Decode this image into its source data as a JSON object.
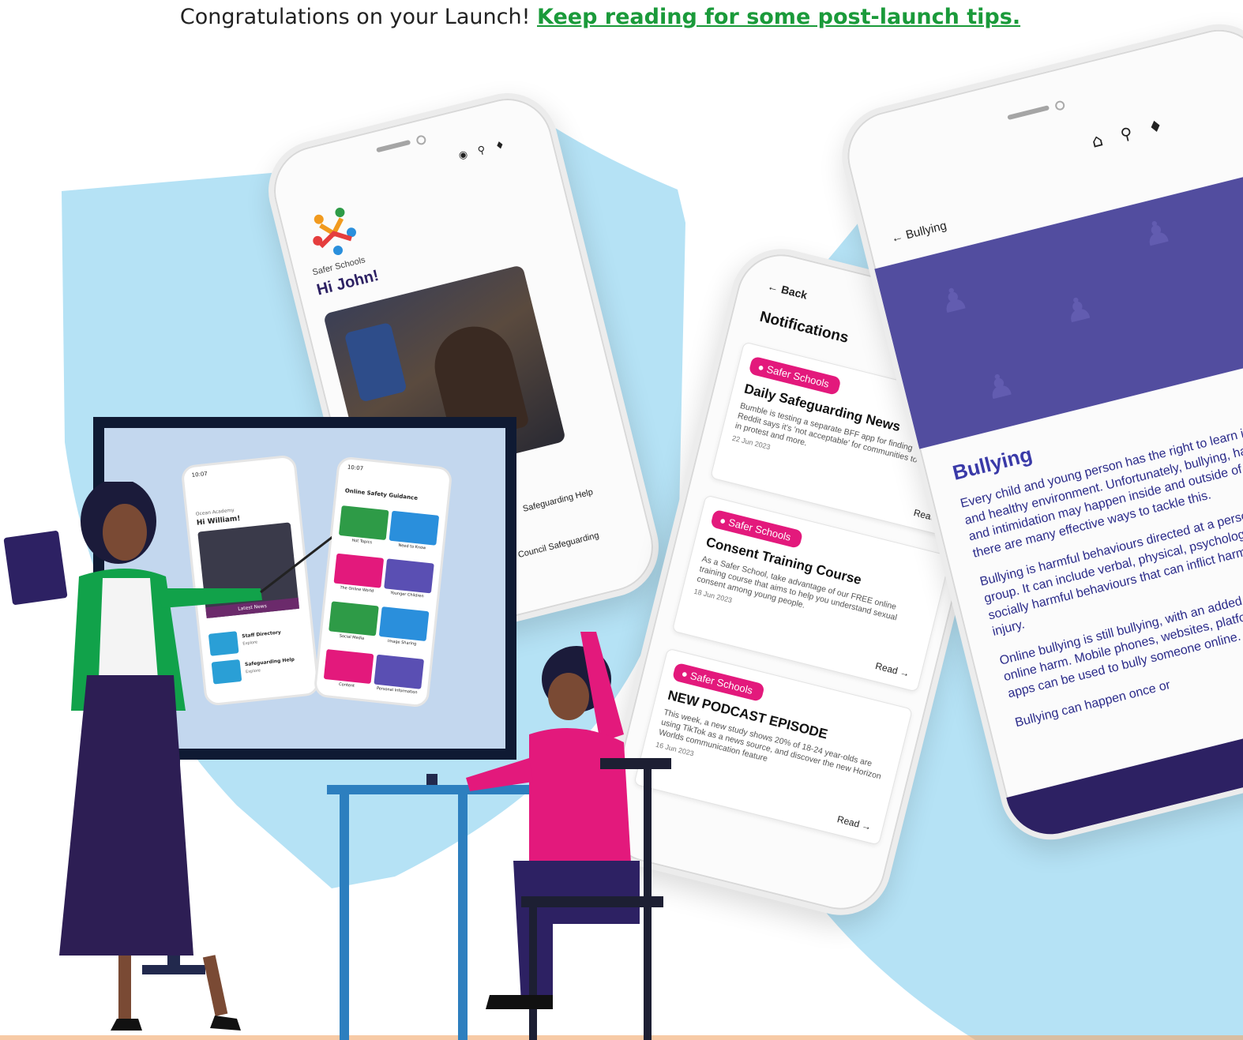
{
  "banner": {
    "lead": "Congratulations on your Launch!",
    "link": "Keep reading for some post-launch tips."
  },
  "colors": {
    "shield": "#b5e2f5",
    "link_green": "#1a9a3a",
    "purple": "#524d9f",
    "pink": "#e3197c",
    "navy": "#2d2163"
  },
  "phone_home": {
    "brand": "Safer Schools",
    "greeting": "Hi John!",
    "news_caption": "Latest News",
    "list_items": [
      "Safeguarding Help",
      "Council Safeguarding"
    ]
  },
  "phone_notifications": {
    "back": "Back",
    "title": "Notifications",
    "cards": [
      {
        "tag": "Safer Schools",
        "title": "Daily Safeguarding News",
        "body": "Bumble is testing a separate BFF app for finding friends. Reddit says it's 'not acceptable' for communities to go NSFW in protest and more.",
        "date": "22 Jun 2023",
        "action": "Read"
      },
      {
        "tag": "Safer Schools",
        "title": "Consent Training Course",
        "body": "As a Safer School, take advantage of our FREE online training course that aims to help you understand sexual consent among young people.",
        "date": "18 Jun 2023",
        "action": "Read"
      },
      {
        "tag": "Safer Schools",
        "title": "NEW PODCAST EPISODE",
        "body": "This week, a new study shows 20% of 18-24 year-olds are using TikTok as a news source, and discover the new Horizon Worlds communication feature",
        "date": "16 Jun 2023",
        "action": "Read"
      }
    ]
  },
  "phone_bullying": {
    "back": "Bullying",
    "heading": "Bullying",
    "paragraphs": [
      "Every child and young person has the right to learn in a safe and healthy environment. Unfortunately, bullying, harassment, and intimidation may happen inside and outside of school, but there are many effective ways to tackle this.",
      "Bullying is harmful behaviours directed at a person or a group. It can include verbal, physical, psychological, or socially harmful behaviours that can inflict harm, stress, or injury.",
      "Online bullying is still bullying, with an added dimension of online harm. Mobile phones, websites, platforms, and gaming apps can be used to bully someone online.",
      "Bullying can happen once or"
    ]
  },
  "board": {
    "phone_left": {
      "time": "10:07",
      "school": "Ocean Academy",
      "greeting": "Hi William!",
      "news_caption": "Latest News",
      "items": [
        {
          "label": "Staff Directory",
          "sub": "Explore"
        },
        {
          "label": "Safeguarding Help",
          "sub": "Explore"
        }
      ]
    },
    "phone_right": {
      "time": "10:07",
      "title": "Online Safety Guidance",
      "tiles": [
        {
          "label": "Hot Topics",
          "color": "#2e9b47"
        },
        {
          "label": "Need to Know",
          "color": "#2a8fdc"
        },
        {
          "label": "The Online World",
          "color": "#e3197c"
        },
        {
          "label": "Younger Children",
          "color": "#5a4fb3"
        },
        {
          "label": "Social Media",
          "color": "#2e9b47"
        },
        {
          "label": "Image Sharing",
          "color": "#2a8fdc"
        },
        {
          "label": "Content",
          "color": "#e3197c"
        },
        {
          "label": "Personal Information",
          "color": "#5a4fb3"
        }
      ]
    }
  }
}
